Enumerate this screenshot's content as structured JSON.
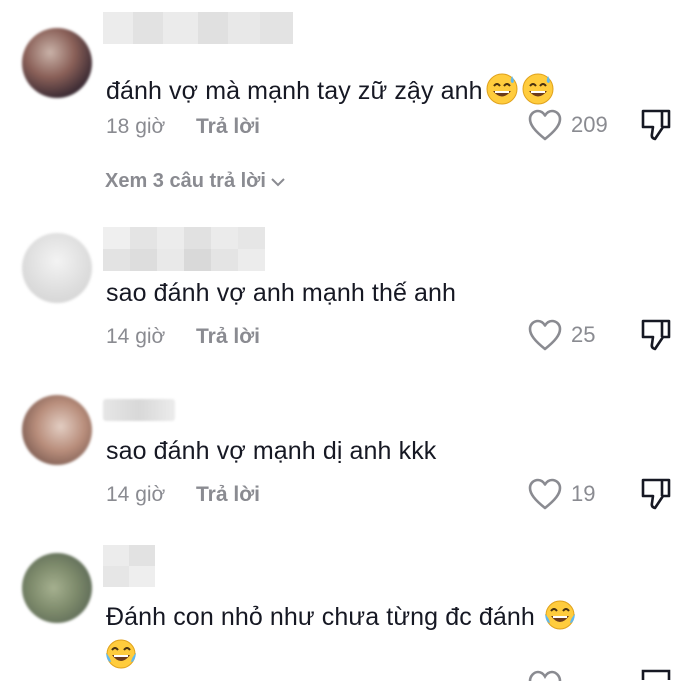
{
  "comments": [
    {
      "text": "đánh vợ mà mạnh tay zữ zậy anh",
      "time": "18 giờ",
      "reply_label": "Trả lời",
      "likes": "209",
      "trailing_emoji": [
        "sweat-smile-emoji",
        "sweat-smile-emoji"
      ],
      "view_replies": "Xem 3 câu trả lời"
    },
    {
      "text": "sao đánh vợ anh mạnh thế anh",
      "time": "14 giờ",
      "reply_label": "Trả lời",
      "likes": "25"
    },
    {
      "text": "sao đánh vợ mạnh dị anh kkk",
      "time": "14 giờ",
      "reply_label": "Trả lời",
      "likes": "19"
    },
    {
      "text": "Đánh con nhỏ như chưa từng đc đánh",
      "trailing_emoji": [
        "tears-of-joy-emoji",
        "tears-of-joy-emoji"
      ]
    }
  ],
  "colors": {
    "text": "#161823",
    "muted": "#8a8b91",
    "emoji_face": "#ffcc3d"
  }
}
